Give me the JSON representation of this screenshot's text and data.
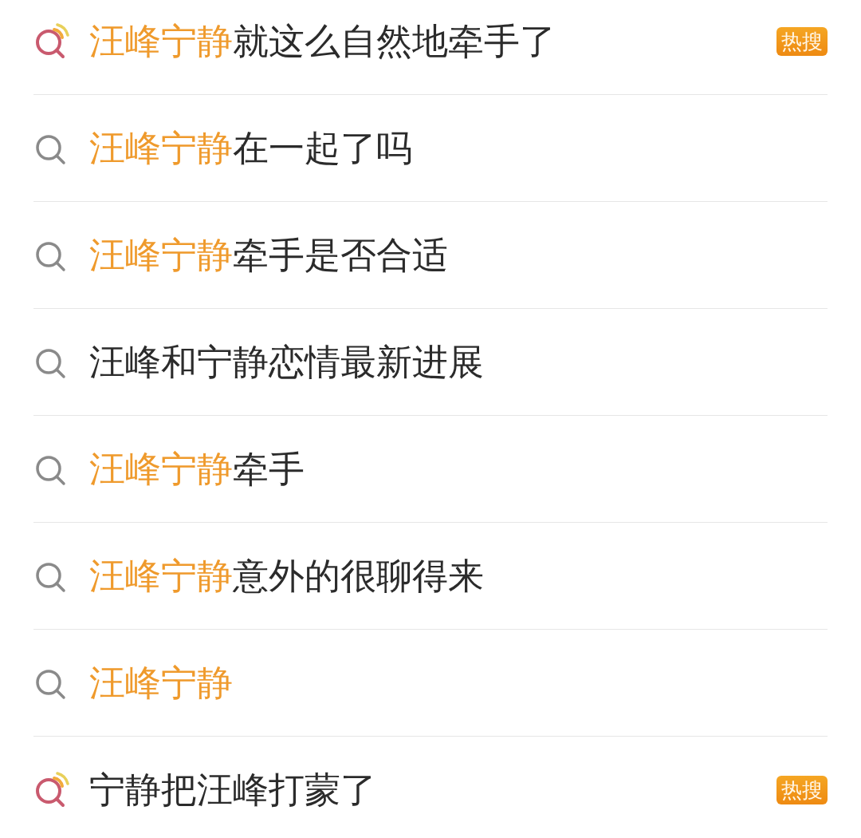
{
  "suggestions": [
    {
      "kind": "hot",
      "text": "**汪峰宁静**就这么自然地牵手了",
      "badge": "热搜"
    },
    {
      "kind": "normal",
      "text": "**汪峰宁静**在一起了吗"
    },
    {
      "kind": "normal",
      "text": "**汪峰宁静**牵手是否合适"
    },
    {
      "kind": "normal",
      "text": "汪峰和宁静恋情最新进展"
    },
    {
      "kind": "normal",
      "text": "**汪峰宁静**牵手"
    },
    {
      "kind": "normal",
      "text": "**汪峰宁静**意外的很聊得来"
    },
    {
      "kind": "normal",
      "text": "**汪峰宁静**"
    },
    {
      "kind": "hot",
      "text": "宁静把汪峰打蒙了",
      "badge": "热搜"
    }
  ]
}
